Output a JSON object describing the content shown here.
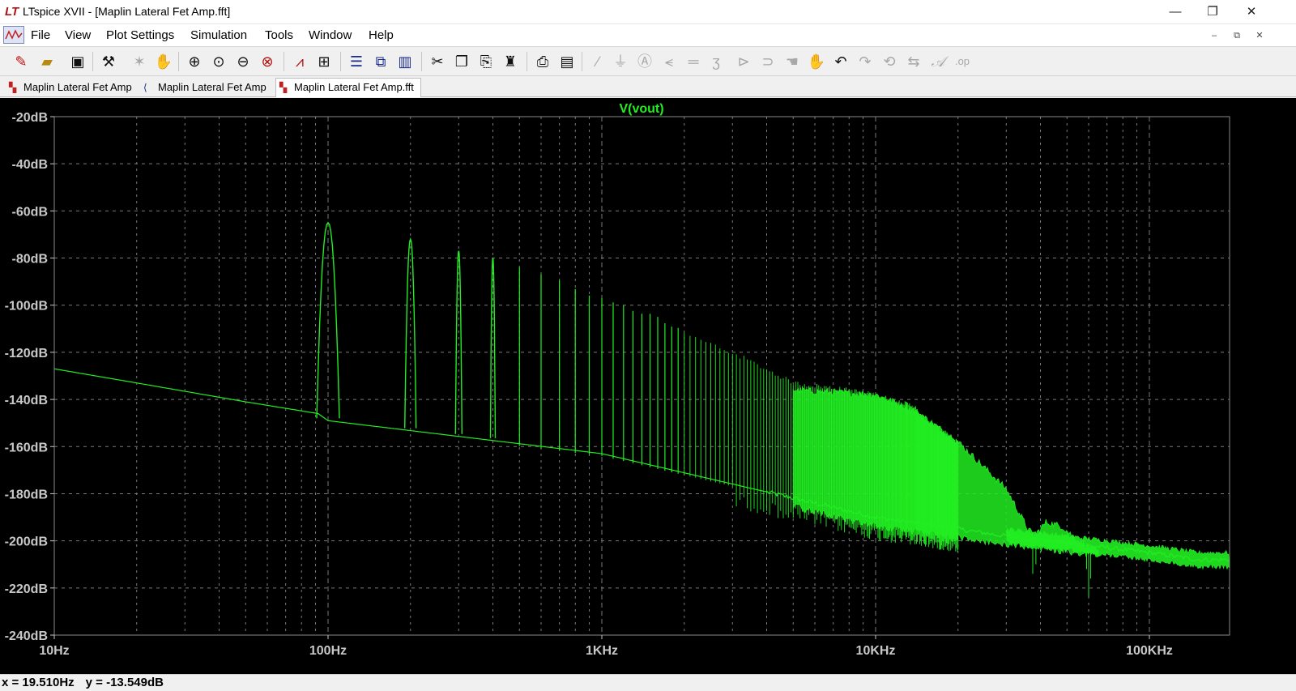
{
  "window": {
    "app_logo": "LT",
    "title": "LTspice XVII - [Maplin Lateral Fet Amp.fft]",
    "minimize": "—",
    "maximize": "❐",
    "close": "✕"
  },
  "menu": {
    "items": [
      "File",
      "View",
      "Plot Settings",
      "Simulation",
      "Tools",
      "Window",
      "Help"
    ],
    "mdi_minimize": "‒",
    "mdi_restore": "⧉",
    "mdi_close": "✕"
  },
  "toolbar": {
    "icons": [
      "open-new-icon",
      "open-folder-icon",
      "save-icon",
      "control-panel-icon",
      "run-icon",
      "halt-icon",
      "zoom-area-icon",
      "zoom-in-icon",
      "zoom-out-icon",
      "zoom-full-icon",
      "autorange-icon",
      "cursor-icon",
      "tile-horizontal-icon",
      "cascade-icon",
      "tile-vertical-icon",
      "cut-icon",
      "copy-icon",
      "paste-icon",
      "find-icon",
      "print-icon",
      "print-setup-icon",
      "wire-icon",
      "ground-icon",
      "label-icon",
      "resistor-icon",
      "capacitor-icon",
      "inductor-icon",
      "diode-icon",
      "component-icon",
      "move-icon",
      "drag-icon",
      "undo-icon",
      "redo-icon",
      "rotate-icon",
      "mirror-icon",
      "text-icon",
      "spice-directive-icon"
    ]
  },
  "tabs": [
    {
      "label": "Maplin Lateral Fet Amp",
      "icon": "waveform-icon",
      "active": false
    },
    {
      "label": "Maplin Lateral Fet Amp",
      "icon": "schematic-icon",
      "active": false
    },
    {
      "label": "Maplin Lateral Fet Amp.fft",
      "icon": "waveform-icon",
      "active": true
    }
  ],
  "colors": {
    "plot_background": "#000000",
    "trace": "#22ee22",
    "grid": "#7a7a7a",
    "axis_text": "#c8c8c8"
  },
  "chart_data": {
    "type": "line",
    "title": "V(vout)",
    "xscale": "log",
    "xlim": [
      10,
      150000
    ],
    "ylim": [
      -240,
      -20
    ],
    "x_ticks": [
      "10Hz",
      "100Hz",
      "1KHz",
      "10KHz",
      "100KHz"
    ],
    "y_ticks": [
      "-20dB",
      "-40dB",
      "-60dB",
      "-80dB",
      "-100dB",
      "-120dB",
      "-140dB",
      "-160dB",
      "-180dB",
      "-200dB",
      "-220dB",
      "-240dB"
    ],
    "grid": true,
    "series": [
      {
        "name": "V(vout)",
        "noise_floor": [
          [
            10,
            -127
          ],
          [
            20,
            -133
          ],
          [
            50,
            -141
          ],
          [
            92,
            -146
          ],
          [
            100,
            -149
          ],
          [
            1000,
            -163
          ],
          [
            10000,
            -190
          ],
          [
            30000,
            -198
          ],
          [
            100000,
            -205
          ],
          [
            150000,
            -208
          ]
        ],
        "harmonics": [
          [
            100,
            -66
          ],
          [
            200,
            -72
          ],
          [
            300,
            -77
          ],
          [
            400,
            -80
          ],
          [
            500,
            -84
          ],
          [
            600,
            -87
          ],
          [
            700,
            -90
          ],
          [
            800,
            -93
          ],
          [
            900,
            -95
          ],
          [
            1000,
            -98
          ],
          [
            1500,
            -104
          ],
          [
            2000,
            -112
          ],
          [
            3000,
            -120
          ],
          [
            5000,
            -133
          ],
          [
            8000,
            -136
          ],
          [
            10000,
            -138
          ],
          [
            14000,
            -143
          ]
        ],
        "upper_envelope": [
          [
            5000,
            -136
          ],
          [
            10000,
            -138
          ],
          [
            14000,
            -145
          ],
          [
            20000,
            -158
          ],
          [
            30000,
            -178
          ],
          [
            36000,
            -195
          ],
          [
            38000,
            -198
          ],
          [
            42000,
            -192
          ],
          [
            48000,
            -194
          ],
          [
            55000,
            -200
          ],
          [
            65000,
            -205
          ]
        ]
      }
    ]
  },
  "status": {
    "x_readout": "x = 19.510Hz",
    "y_readout": "y = -13.549dB"
  }
}
